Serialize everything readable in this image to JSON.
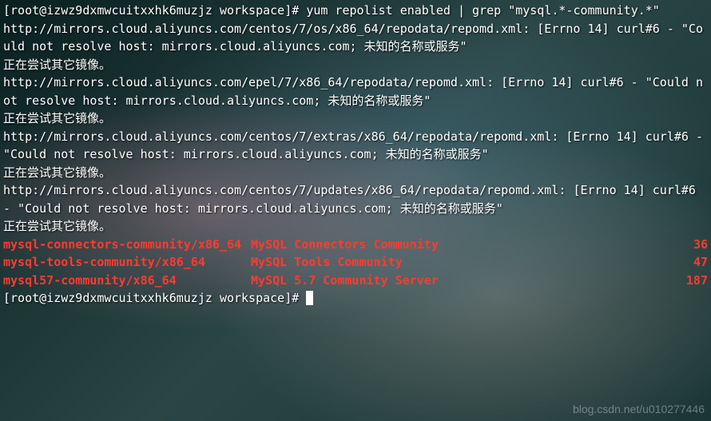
{
  "prompt": {
    "user": "root",
    "host": "izwz9dxmwcuitxxhk6muzjz",
    "dir": "workspace",
    "sep": "@",
    "open": "[",
    "close": "]#"
  },
  "command": "yum repolist enabled | grep \"mysql.*-community.*\"",
  "errors": [
    {
      "url": "http://mirrors.cloud.aliyuncs.com/centos/7/os/x86_64/repodata/repomd.xml",
      "errno": "[Errno 14]",
      "curl": "curl#6 - \"Could not resolve host: mirrors.cloud.aliyuncs.com; 未知的名称或服务\"",
      "retry": "正在尝试其它镜像。"
    },
    {
      "url": "http://mirrors.cloud.aliyuncs.com/epel/7/x86_64/repodata/repomd.xml",
      "errno": "[Errno 14]",
      "curl": "curl#6 - \"Could not resolve host: mirrors.cloud.aliyuncs.com; 未知的名称或服务\"",
      "retry": "正在尝试其它镜像。"
    },
    {
      "url": "http://mirrors.cloud.aliyuncs.com/centos/7/extras/x86_64/repodata/repomd.xml",
      "errno": "[Errno 14]",
      "curl": "curl#6 - \"Could not resolve host: mirrors.cloud.aliyuncs.com; 未知的名称或服务\"",
      "retry": "正在尝试其它镜像。"
    },
    {
      "url": "http://mirrors.cloud.aliyuncs.com/centos/7/updates/x86_64/repodata/repomd.xml",
      "errno": "[Errno 14]",
      "curl": "curl#6 - \"Could not resolve host: mirrors.cloud.aliyuncs.com; 未知的名称或服务\"",
      "retry": "正在尝试其它镜像。"
    }
  ],
  "repos": [
    {
      "name": "mysql-connectors-community/x86_64",
      "desc": "MySQL Connectors Community",
      "count": "36"
    },
    {
      "name": "mysql-tools-community/x86_64",
      "desc": "MySQL Tools Community",
      "count": "47"
    },
    {
      "name": "mysql57-community/x86_64",
      "desc": "MySQL 5.7 Community Server",
      "count": "187"
    }
  ],
  "watermark": "blog.csdn.net/u010277446"
}
